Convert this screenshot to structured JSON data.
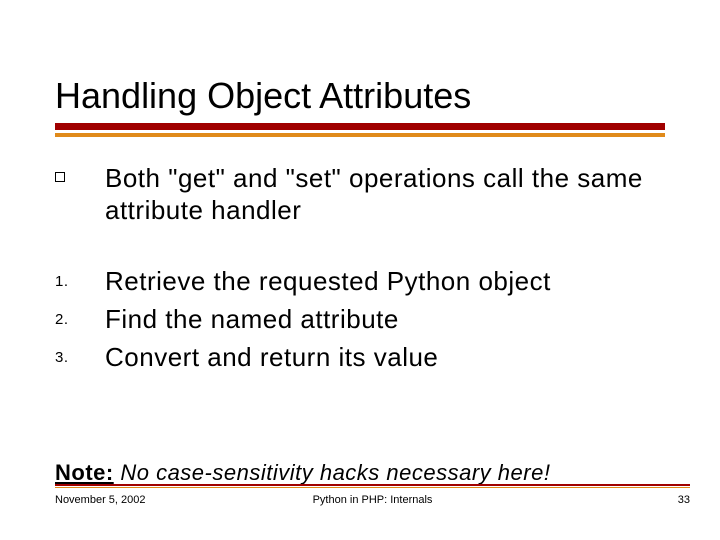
{
  "title": "Handling Object Attributes",
  "bullets": {
    "intro": "Both \"get\" and \"set\" operations call the same attribute handler",
    "n1": "Retrieve the requested Python object",
    "n2": "Find the named attribute",
    "n3": "Convert and return its value",
    "m1": "1.",
    "m2": "2.",
    "m3": "3."
  },
  "note": {
    "label": "Note:",
    "text": " No case-sensitivity hacks necessary here!"
  },
  "footer": {
    "date": "November 5, 2002",
    "center": "Python in PHP: Internals",
    "page": "33"
  }
}
